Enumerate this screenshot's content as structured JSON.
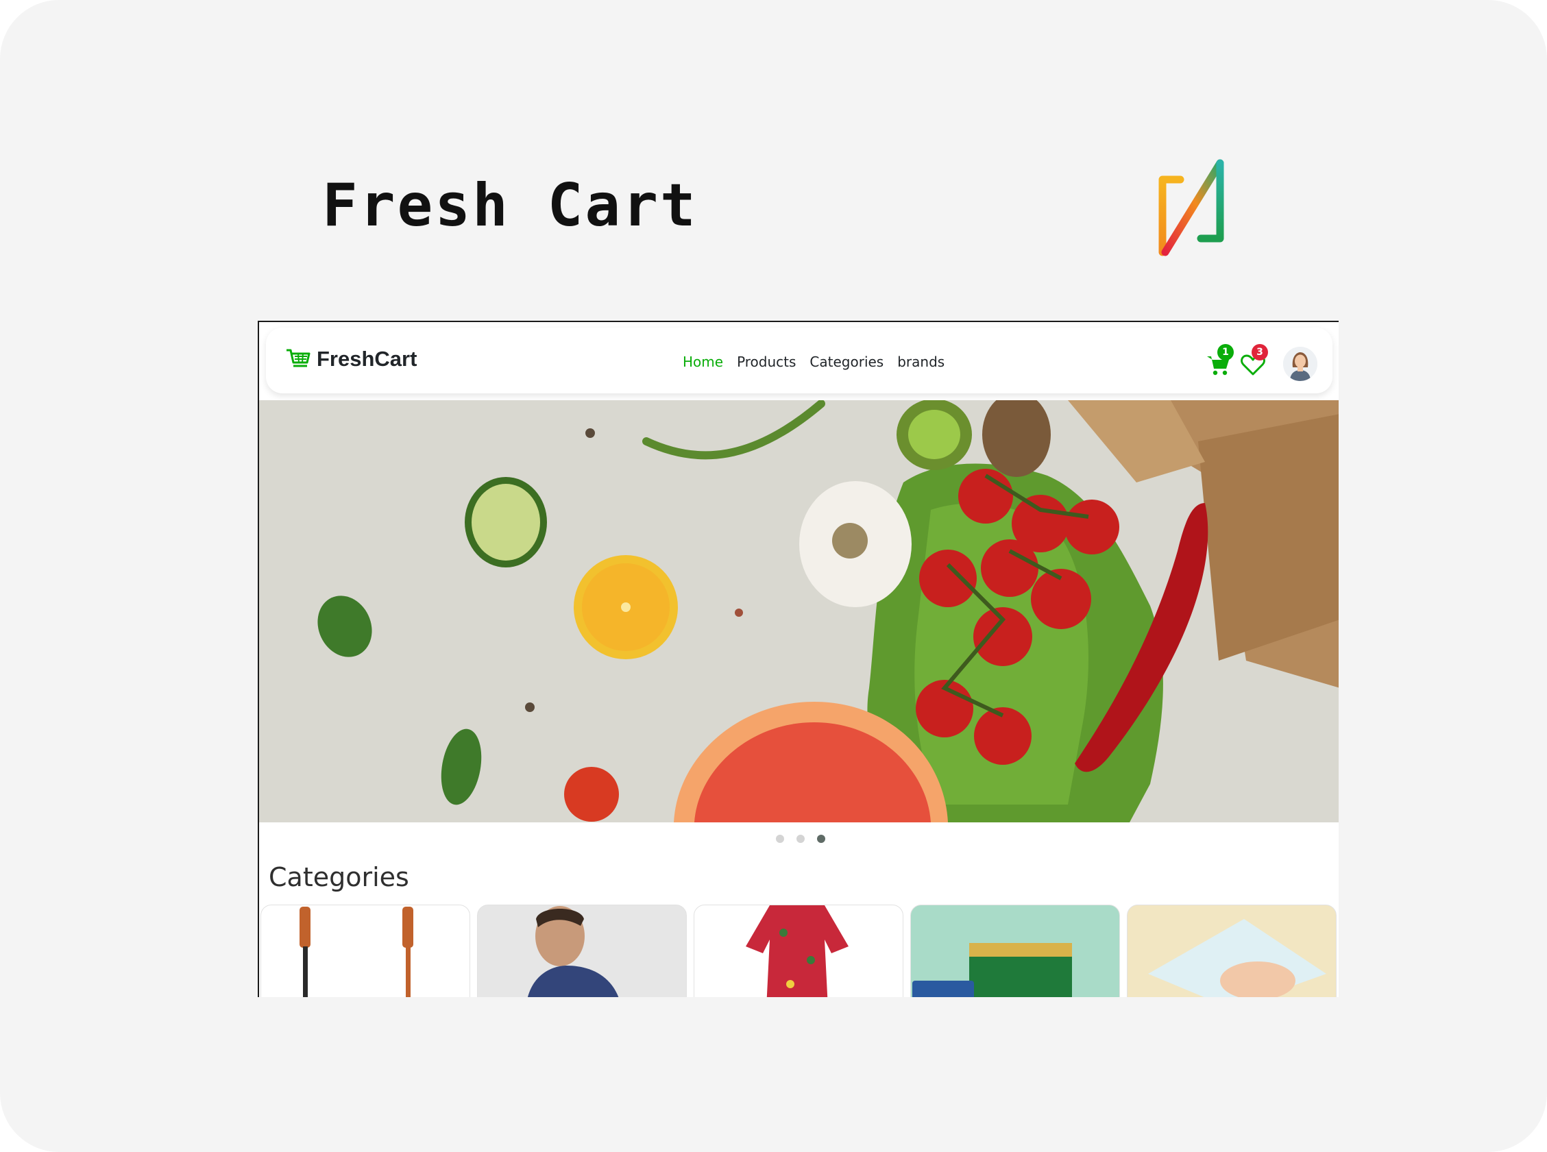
{
  "project": {
    "title": "Fresh Cart",
    "brand_logo_icon": "gradient-m-logo-icon"
  },
  "app": {
    "logo_text": "FreshCart",
    "logo_icon": "shopping-cart-icon",
    "accent_color": "#0aad0a"
  },
  "nav": {
    "links": [
      {
        "label": "Home",
        "active": true
      },
      {
        "label": "Products",
        "active": false
      },
      {
        "label": "Categories",
        "active": false
      },
      {
        "label": "brands",
        "active": false
      }
    ]
  },
  "header_icons": {
    "cart_count": "1",
    "wishlist_count": "3",
    "cart_icon": "cart-icon",
    "wishlist_icon": "heart-icon",
    "avatar_icon": "user-avatar"
  },
  "slider": {
    "slide_count": 3,
    "active_slide": 3
  },
  "categories": {
    "title": "Categories",
    "items": [
      {
        "image": "guitars-image"
      },
      {
        "image": "men-fashion-image"
      },
      {
        "image": "women-dress-image"
      },
      {
        "image": "supermarket-image"
      },
      {
        "image": "baby-diapers-image"
      }
    ]
  }
}
